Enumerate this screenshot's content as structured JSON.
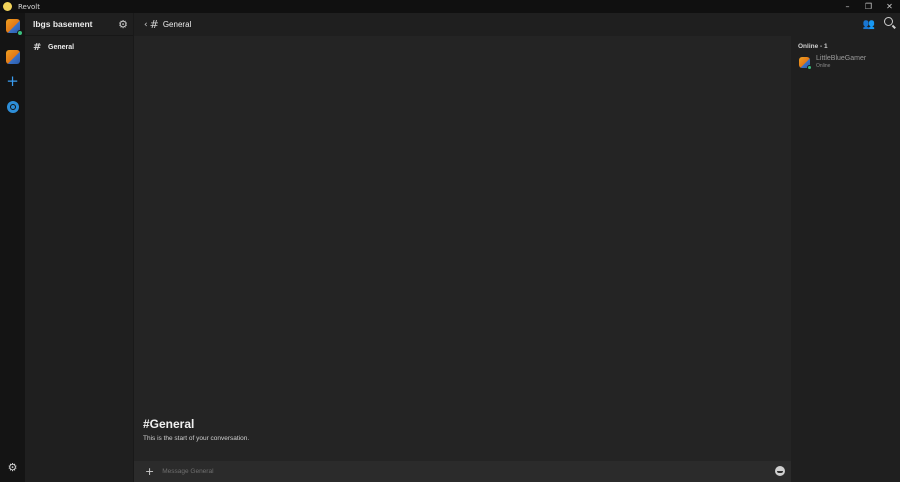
{
  "window": {
    "title": "Revolt",
    "minimize": "–",
    "restore": "❐",
    "close": "✕"
  },
  "server": {
    "name": "lbgs basement"
  },
  "channels": [
    {
      "name": "General"
    }
  ],
  "header": {
    "channel": "General",
    "back": "‹",
    "hash": "#"
  },
  "intro": {
    "title": "#General",
    "subtitle": "This is the start of your conversation."
  },
  "composer": {
    "placeholder": "Message General",
    "plus": "+"
  },
  "members": {
    "heading": "Online - 1",
    "list": [
      {
        "name": "LittleBlueGamer",
        "status": "Online"
      }
    ]
  },
  "icons": {
    "gear": "⚙",
    "hash": "#",
    "plus": "+",
    "members": "👥"
  },
  "colors": {
    "accent": "#3a9cf0",
    "online": "#3abf7e",
    "avatar": "#e07818"
  }
}
